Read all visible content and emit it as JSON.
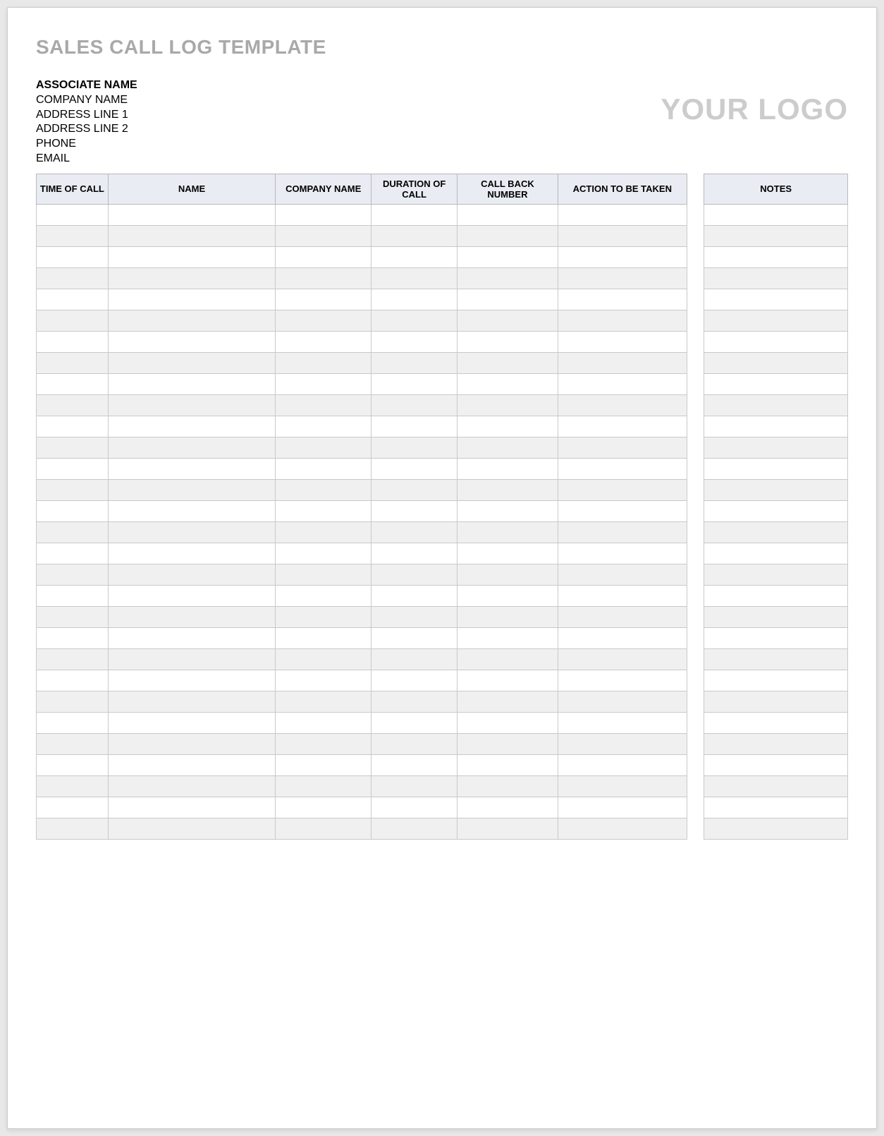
{
  "title": "SALES CALL LOG TEMPLATE",
  "associate": {
    "name_label": "ASSOCIATE NAME",
    "company_label": "COMPANY NAME",
    "address1_label": "ADDRESS LINE 1",
    "address2_label": "ADDRESS LINE 2",
    "phone_label": "PHONE",
    "email_label": "EMAIL"
  },
  "logo_placeholder": "YOUR LOGO",
  "columns": {
    "time_of_call": "TIME OF CALL",
    "name": "NAME",
    "company_name": "COMPANY NAME",
    "duration_of_call": "DURATION OF CALL",
    "call_back_number": "CALL BACK NUMBER",
    "action_to_be_taken": "ACTION TO BE TAKEN",
    "notes": "NOTES"
  },
  "row_count": 30
}
